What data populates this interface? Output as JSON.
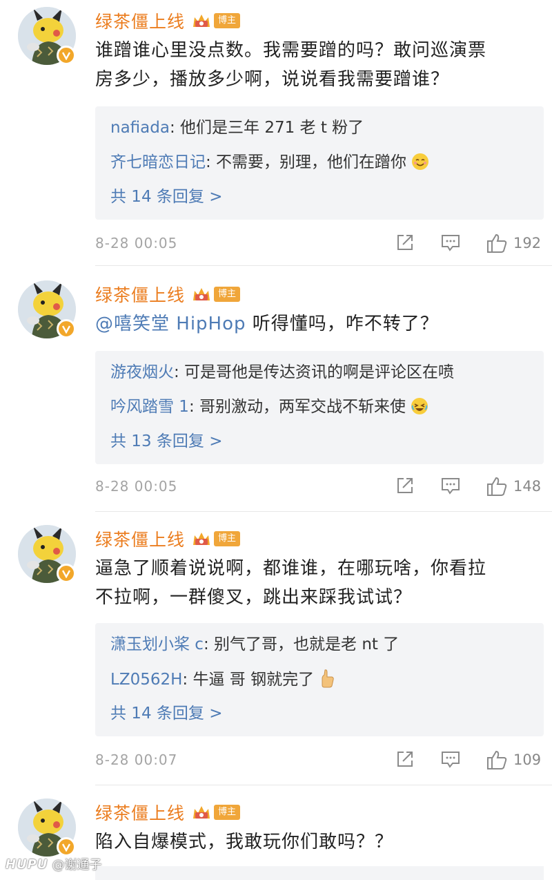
{
  "comments": [
    {
      "username": "绿茶僵上线",
      "badge": "博主",
      "text_lines": [
        "谁蹭谁心里没点数。我需要蹭的吗？敢问巡演票",
        "房多少，播放多少啊，说说看我需要蹭谁？"
      ],
      "mention": "",
      "replies": [
        {
          "author": "nafiada",
          "text": ": 他们是三年 271 老 t 粉了",
          "emoji": ""
        },
        {
          "author": "齐七暗恋日记",
          "text": ": 不需要，别理，他们在蹭你 ",
          "emoji": "smile"
        }
      ],
      "more": "共 14 条回复 >",
      "time": "8-28 00:05",
      "likes": "192"
    },
    {
      "username": "绿茶僵上线",
      "badge": "博主",
      "text_lines": [
        " 听得懂吗，咋不转了？"
      ],
      "mention": "@嘻笑堂 HipHop",
      "replies": [
        {
          "author": "游夜烟火",
          "text": ": 可是哥他是传达资讯的啊是评论区在喷",
          "emoji": ""
        },
        {
          "author": "吟风踏雪 1",
          "text": ": 哥别激动，两军交战不斩来使 ",
          "emoji": "laugh"
        }
      ],
      "more": "共 13 条回复 >",
      "time": "8-28 00:05",
      "likes": "148"
    },
    {
      "username": "绿茶僵上线",
      "badge": "博主",
      "text_lines": [
        "逼急了顺着说说啊，都谁谁，在哪玩啥，你看拉",
        "不拉啊，一群傻叉，跳出来踩我试试？"
      ],
      "mention": "",
      "replies": [
        {
          "author": "潇玉划小桨 c",
          "text": ": 别气了哥，也就是老 nt 了",
          "emoji": ""
        },
        {
          "author": "LZ0562H",
          "text": ": 牛逼 哥 钢就完了 ",
          "emoji": "thumb"
        }
      ],
      "more": "共 14 条回复 >",
      "time": "8-28 00:07",
      "likes": "109"
    },
    {
      "username": "绿茶僵上线",
      "badge": "博主",
      "text_lines": [
        "陷入自爆模式，我敢玩你们敢吗？？"
      ],
      "mention": ""
    }
  ],
  "watermark": {
    "brand": "HUPU",
    "author": "@谢通子"
  },
  "colors": {
    "username": "#eb7d1f",
    "link": "#4e7bb5",
    "badge": "#f0a63a",
    "reply_bg": "#f3f4f6"
  },
  "icons": [
    "avatar-pikachu",
    "verified-icon",
    "crown-icon",
    "share-icon",
    "comment-icon",
    "like-icon"
  ]
}
